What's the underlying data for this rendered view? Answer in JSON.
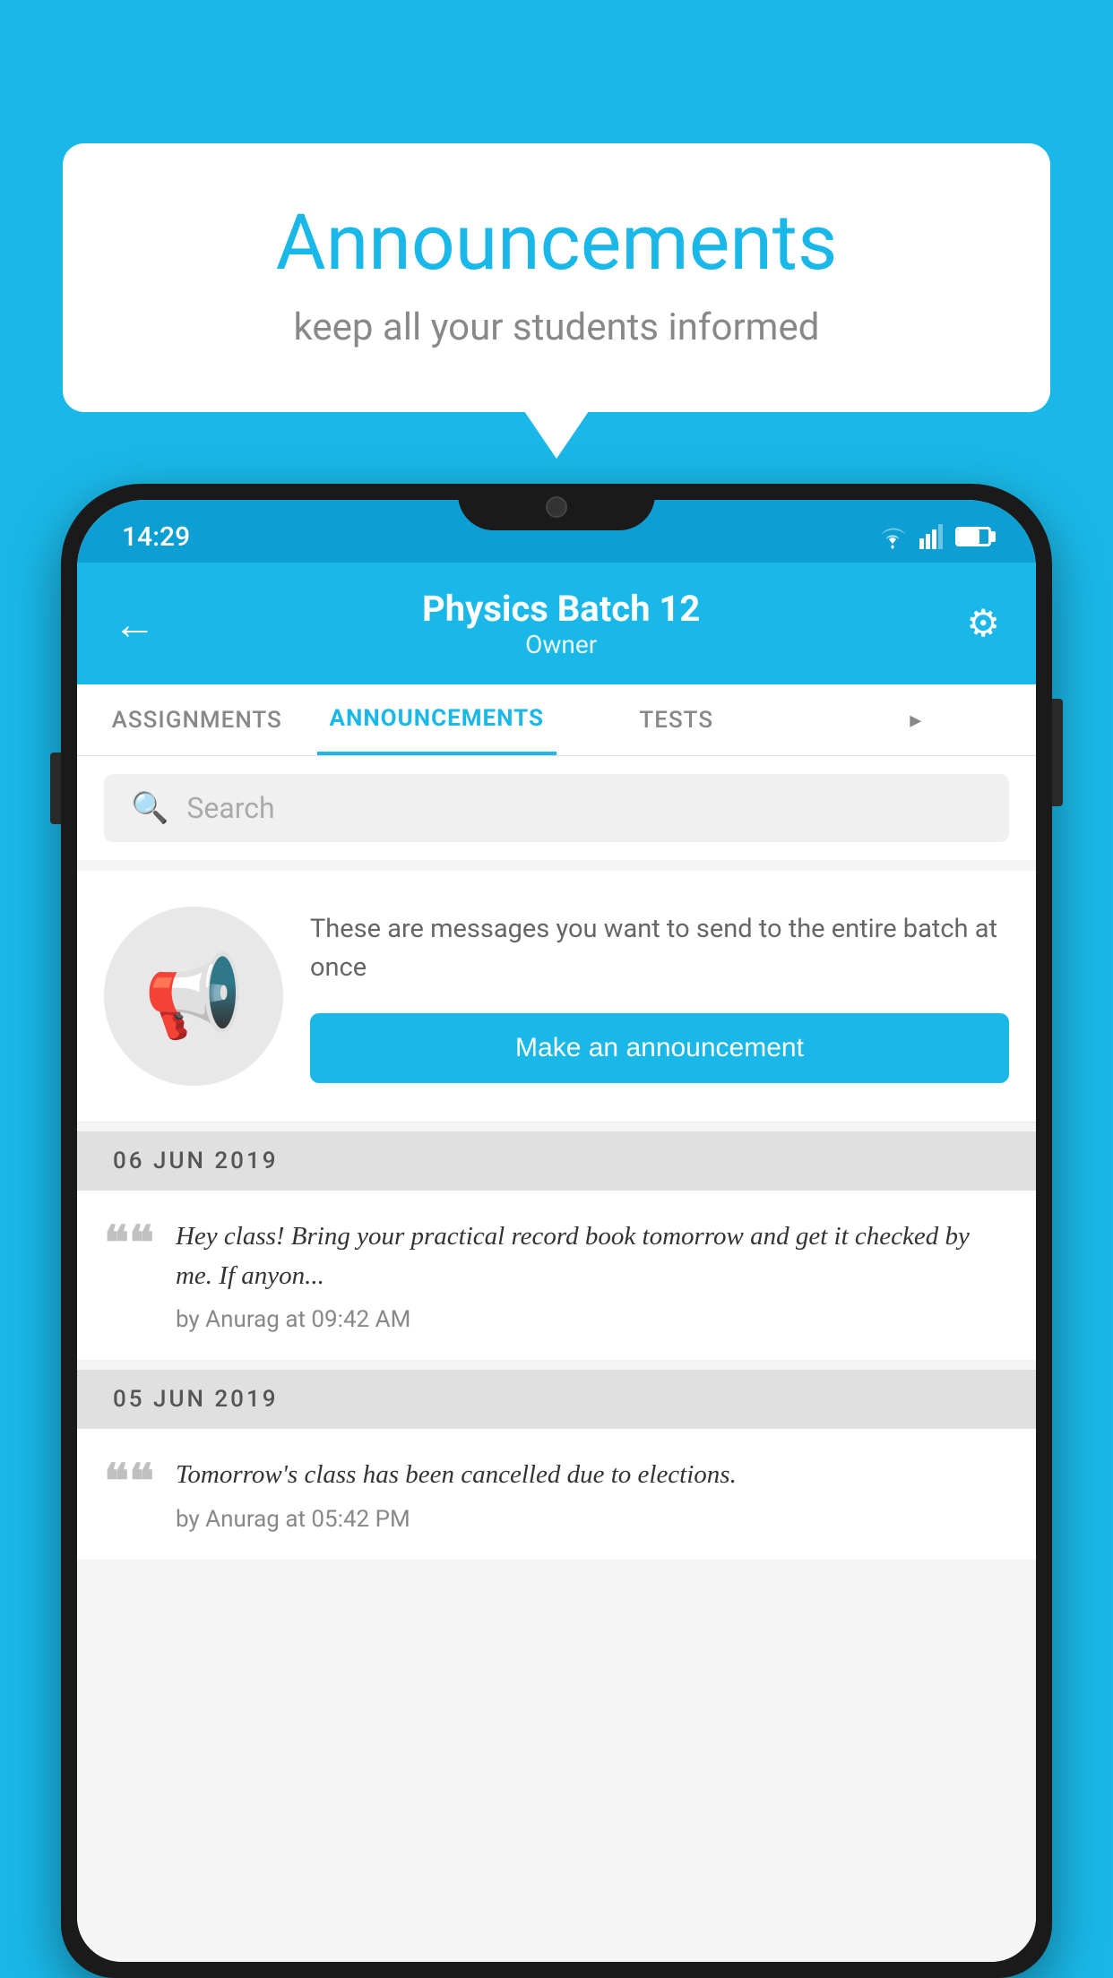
{
  "background_color": "#1ab8e8",
  "speech_bubble": {
    "title": "Announcements",
    "subtitle": "keep all your students informed"
  },
  "phone": {
    "status_bar": {
      "time": "14:29"
    },
    "header": {
      "title": "Physics Batch 12",
      "subtitle": "Owner",
      "back_label": "←",
      "gear_label": "⚙"
    },
    "tabs": [
      {
        "label": "ASSIGNMENTS",
        "active": false
      },
      {
        "label": "ANNOUNCEMENTS",
        "active": true
      },
      {
        "label": "TESTS",
        "active": false
      },
      {
        "label": "",
        "active": false
      }
    ],
    "search": {
      "placeholder": "Search"
    },
    "cta": {
      "description": "These are messages you want to send to the entire batch at once",
      "button_label": "Make an announcement"
    },
    "announcements": [
      {
        "date": "06  JUN  2019",
        "text": "Hey class! Bring your practical record book tomorrow and get it checked by me. If anyon...",
        "meta": "by Anurag at 09:42 AM"
      },
      {
        "date": "05  JUN  2019",
        "text": "Tomorrow's class has been cancelled due to elections.",
        "meta": "by Anurag at 05:42 PM"
      }
    ]
  }
}
